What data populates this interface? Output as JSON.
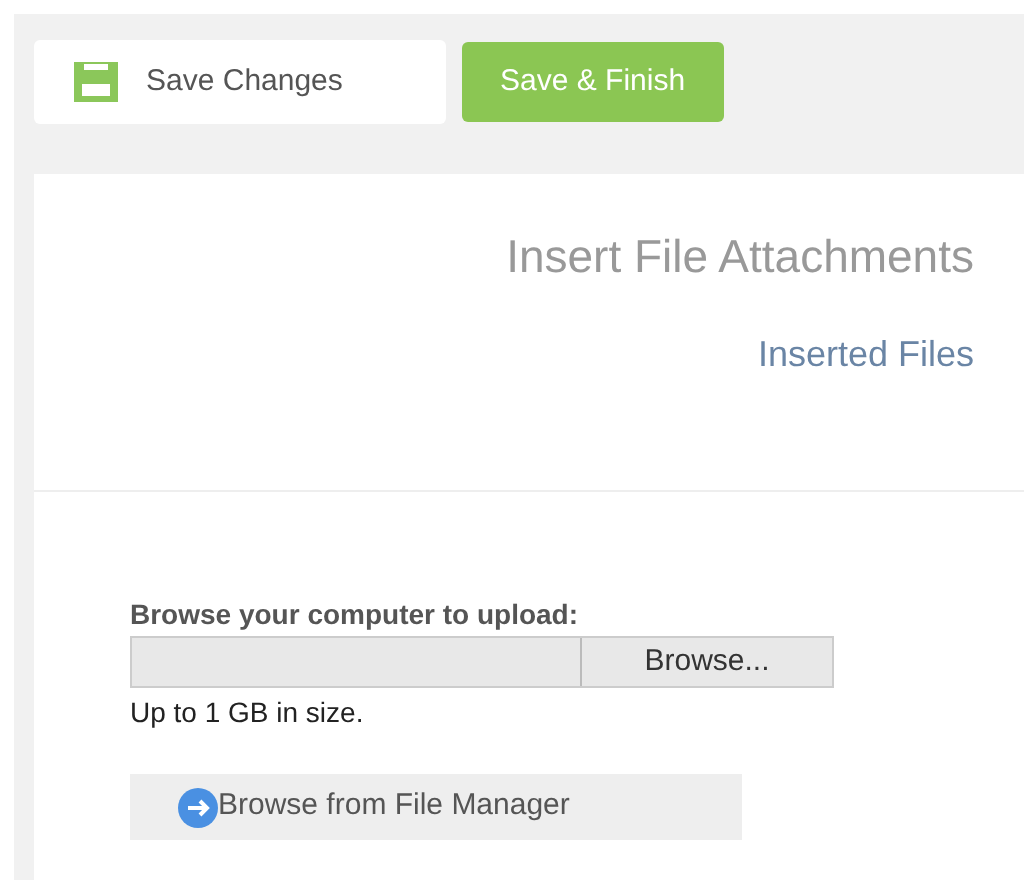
{
  "toolbar": {
    "save_button": "Save Changes",
    "finish_button": "Save & Finish"
  },
  "panel": {
    "title": "Insert File Attachments",
    "subtitle": "Inserted Files"
  },
  "upload": {
    "label": "Browse your computer to upload:",
    "browse_button": "Browse...",
    "hint": "Up to 1 GB in size.",
    "file_manager_button": "Browse from File Manager"
  }
}
